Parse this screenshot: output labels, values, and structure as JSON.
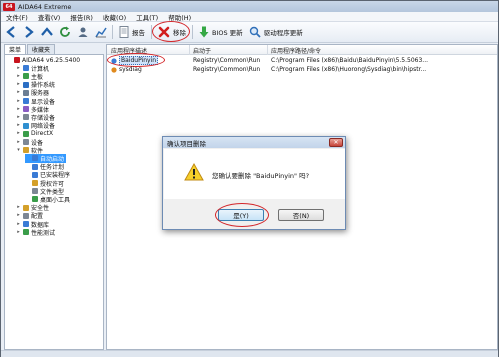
{
  "window": {
    "title": "AIDA64 Extreme",
    "logo_text": "64"
  },
  "menu": [
    "文件(F)",
    "查看(V)",
    "报告(R)",
    "收藏(O)",
    "工具(T)",
    "帮助(H)"
  ],
  "toolbar": {
    "report_label": "报告",
    "remove_label": "移除",
    "bios_update_label": "BIOS 更新",
    "driver_update_label": "驱动程序更新"
  },
  "left_tabs": [
    "菜单",
    "收藏夹"
  ],
  "tree": [
    {
      "label": "AIDA64 v6.25.5400",
      "indent": 0,
      "expander": "",
      "color": "#c8141e"
    },
    {
      "label": "计算机",
      "indent": 1,
      "expander": "▸",
      "color": "#3a7bd5"
    },
    {
      "label": "主板",
      "indent": 1,
      "expander": "▸",
      "color": "#3a9d4a"
    },
    {
      "label": "操作系统",
      "indent": 1,
      "expander": "▸",
      "color": "#2c6fc4"
    },
    {
      "label": "服务器",
      "indent": 1,
      "expander": "▸",
      "color": "#6b7d93"
    },
    {
      "label": "显示设备",
      "indent": 1,
      "expander": "▸",
      "color": "#3a7bd5"
    },
    {
      "label": "多媒体",
      "indent": 1,
      "expander": "▸",
      "color": "#8a5cc4"
    },
    {
      "label": "存储设备",
      "indent": 1,
      "expander": "▸",
      "color": "#7d8794"
    },
    {
      "label": "网络设备",
      "indent": 1,
      "expander": "▸",
      "color": "#2f8fd0"
    },
    {
      "label": "DirectX",
      "indent": 1,
      "expander": "▸",
      "color": "#3a9d4a"
    },
    {
      "label": "设备",
      "indent": 1,
      "expander": "▸",
      "color": "#7d8794"
    },
    {
      "label": "软件",
      "indent": 1,
      "expander": "▾",
      "color": "#d4a02a"
    },
    {
      "label": "自动启动",
      "indent": 2,
      "expander": "",
      "color": "#3a7bd5",
      "selected": true
    },
    {
      "label": "任务计划",
      "indent": 2,
      "expander": "",
      "color": "#3a7bd5"
    },
    {
      "label": "已安装程序",
      "indent": 2,
      "expander": "",
      "color": "#3a7bd5"
    },
    {
      "label": "授权许可",
      "indent": 2,
      "expander": "",
      "color": "#d4a02a"
    },
    {
      "label": "文件类型",
      "indent": 2,
      "expander": "",
      "color": "#7d8794"
    },
    {
      "label": "桌面小工具",
      "indent": 2,
      "expander": "",
      "color": "#3a9d4a"
    },
    {
      "label": "安全性",
      "indent": 1,
      "expander": "▸",
      "color": "#d4a02a"
    },
    {
      "label": "配置",
      "indent": 1,
      "expander": "▸",
      "color": "#7d8794"
    },
    {
      "label": "数据库",
      "indent": 1,
      "expander": "▸",
      "color": "#3a7bd5"
    },
    {
      "label": "性能测试",
      "indent": 1,
      "expander": "▸",
      "color": "#3a9d4a"
    }
  ],
  "list": {
    "columns": [
      "应用程序描述",
      "启动于",
      "应用程序路径/命令"
    ],
    "rows": [
      {
        "name": "BaiduPinyin",
        "start": "Registry\\Common\\Run",
        "path": "C:\\Program Files (x86)\\Baidu\\BaiduPinyin\\5.5.5063...",
        "selected": true
      },
      {
        "name": "sysdiag",
        "start": "Registry\\Common\\Run",
        "path": "C:\\Program Files (x86)\\Huorong\\Sysdiag\\bin\\hipstr..."
      }
    ]
  },
  "dialog": {
    "title": "确认项目删除",
    "message": "您确认要删除 \"BaiduPinyin\" 吗?",
    "yes_label": "是(Y)",
    "no_label": "否(N)",
    "close_glyph": "✕"
  },
  "colors": {
    "highlight": "#d3262a",
    "accent": "#3c7fb1"
  }
}
